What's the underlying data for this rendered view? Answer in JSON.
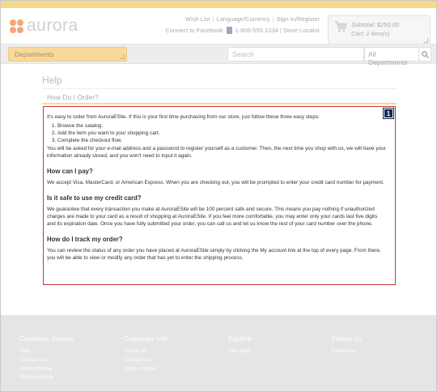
{
  "header": {
    "logo_text": "aurora",
    "util_links": [
      "Wish List",
      "Language/Currency",
      "Sign In/Register"
    ],
    "connect_label": "Connect to Facebook",
    "phone": "1-800-555-1234",
    "store_locator": "Store Locator",
    "cart": {
      "subtotal": "Subtotal: $250.00",
      "items": "Cart: 2 item(s)"
    }
  },
  "nav": {
    "departments_label": "Departments",
    "search_placeholder": "Search",
    "search_scope": "All Departments"
  },
  "page": {
    "title": "Help",
    "subtitle": "How Do I Order?",
    "badge": "1",
    "intro": "It's easy to order from AuroraESite. If this is your first time purchasing from our store, just follow these three easy steps:",
    "steps": [
      "Browse the catalog.",
      "Add the item you want to your shopping cart.",
      "Complete the checkout flow."
    ],
    "after_steps": "You will be asked for your e-mail address and a password to register yourself as a customer. Then, the next time you shop with us, we will have your information already stored, and you won't need to input it again.",
    "sections": [
      {
        "heading": "How can I pay?",
        "body": "We accept Visa, MasterCard, or American Express. When you are checking out, you will be prompted to enter your credit card number for payment."
      },
      {
        "heading": "Is it safe to use my credit card?",
        "body": "We guarantee that every transaction you make at AuroraESite will be 100 percent safe and secure. This means you pay nothing if unauthorized charges are made to your card as a result of shopping at AuroraESite. If you feel more comfortable, you may enter only your cards last five digits and its expiration date. Once you have fully submitted your order, you can call us and let us know the rest of your card number over the phone."
      },
      {
        "heading": "How do I track my order?",
        "body": "You can review the status of any order you have placed at AuroraESite simply by clicking the My account link at the top of every page. From there, you will be able to view or modify any order that has yet to enter the shipping process."
      }
    ]
  },
  "footer": {
    "columns": [
      {
        "title": "Customer Service",
        "links": [
          "Help",
          "Contact Us",
          "Return Policy",
          "Privacy Policy"
        ]
      },
      {
        "title": "Corporate Info",
        "links": [
          "About Us",
          "Contact Us",
          "Store Locator"
        ]
      },
      {
        "title": "Explore",
        "links": [
          "Site Map"
        ]
      },
      {
        "title": "Follow Us",
        "links": [
          "Facebook"
        ]
      }
    ]
  },
  "colors": {
    "accent": "#f8d99a",
    "highlight_border": "#c5363b",
    "badge": "#0e2a56",
    "footer_bg": "#e5e5e5"
  }
}
